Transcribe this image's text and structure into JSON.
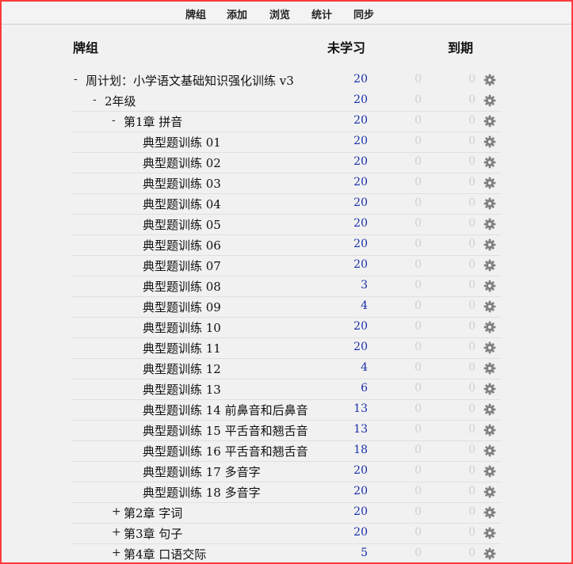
{
  "topbar": {
    "decks": "牌组",
    "add": "添加",
    "browse": "浏览",
    "stats": "统计",
    "sync": "同步"
  },
  "header": {
    "deck": "牌组",
    "new": "未学习",
    "due": "到期"
  },
  "colors": {
    "new": "#1a2fa8",
    "zero": "#cfcfcf",
    "gear": "#808080",
    "frame": "#ff3b3b"
  },
  "icons": {
    "gear": "gear-icon"
  },
  "rows": [
    {
      "toggle": "-",
      "name": "周计划：小学语文基础知识强化训练 v3",
      "level": 0,
      "new": "20",
      "learn": "0",
      "due": "0"
    },
    {
      "toggle": "-",
      "name": "2年级",
      "level": 1,
      "new": "20",
      "learn": "0",
      "due": "0"
    },
    {
      "toggle": "-",
      "name": "第1章 拼音",
      "level": 2,
      "new": "20",
      "learn": "0",
      "due": "0"
    },
    {
      "toggle": "",
      "name": "典型题训练 01",
      "level": 3,
      "new": "20",
      "learn": "0",
      "due": "0"
    },
    {
      "toggle": "",
      "name": "典型题训练 02",
      "level": 3,
      "new": "20",
      "learn": "0",
      "due": "0"
    },
    {
      "toggle": "",
      "name": "典型题训练 03",
      "level": 3,
      "new": "20",
      "learn": "0",
      "due": "0"
    },
    {
      "toggle": "",
      "name": "典型题训练 04",
      "level": 3,
      "new": "20",
      "learn": "0",
      "due": "0"
    },
    {
      "toggle": "",
      "name": "典型题训练 05",
      "level": 3,
      "new": "20",
      "learn": "0",
      "due": "0"
    },
    {
      "toggle": "",
      "name": "典型题训练 06",
      "level": 3,
      "new": "20",
      "learn": "0",
      "due": "0"
    },
    {
      "toggle": "",
      "name": "典型题训练 07",
      "level": 3,
      "new": "20",
      "learn": "0",
      "due": "0"
    },
    {
      "toggle": "",
      "name": "典型题训练 08",
      "level": 3,
      "new": "3",
      "learn": "0",
      "due": "0"
    },
    {
      "toggle": "",
      "name": "典型题训练 09",
      "level": 3,
      "new": "4",
      "learn": "0",
      "due": "0"
    },
    {
      "toggle": "",
      "name": "典型题训练 10",
      "level": 3,
      "new": "20",
      "learn": "0",
      "due": "0"
    },
    {
      "toggle": "",
      "name": "典型题训练 11",
      "level": 3,
      "new": "20",
      "learn": "0",
      "due": "0"
    },
    {
      "toggle": "",
      "name": "典型题训练 12",
      "level": 3,
      "new": "4",
      "learn": "0",
      "due": "0"
    },
    {
      "toggle": "",
      "name": "典型题训练 13",
      "level": 3,
      "new": "6",
      "learn": "0",
      "due": "0"
    },
    {
      "toggle": "",
      "name": "典型题训练 14 前鼻音和后鼻音",
      "level": 3,
      "new": "13",
      "learn": "0",
      "due": "0"
    },
    {
      "toggle": "",
      "name": "典型题训练 15 平舌音和翘舌音",
      "level": 3,
      "new": "13",
      "learn": "0",
      "due": "0"
    },
    {
      "toggle": "",
      "name": "典型题训练 16 平舌音和翘舌音",
      "level": 3,
      "new": "18",
      "learn": "0",
      "due": "0"
    },
    {
      "toggle": "",
      "name": "典型题训练 17 多音字",
      "level": 3,
      "new": "20",
      "learn": "0",
      "due": "0"
    },
    {
      "toggle": "",
      "name": "典型题训练 18 多音字",
      "level": 3,
      "new": "20",
      "learn": "0",
      "due": "0"
    },
    {
      "toggle": "+",
      "name": "第2章 字词",
      "level": 2,
      "new": "20",
      "learn": "0",
      "due": "0"
    },
    {
      "toggle": "+",
      "name": "第3章 句子",
      "level": 2,
      "new": "20",
      "learn": "0",
      "due": "0"
    },
    {
      "toggle": "+",
      "name": "第4章 口语交际",
      "level": 2,
      "new": "5",
      "learn": "0",
      "due": "0"
    }
  ]
}
